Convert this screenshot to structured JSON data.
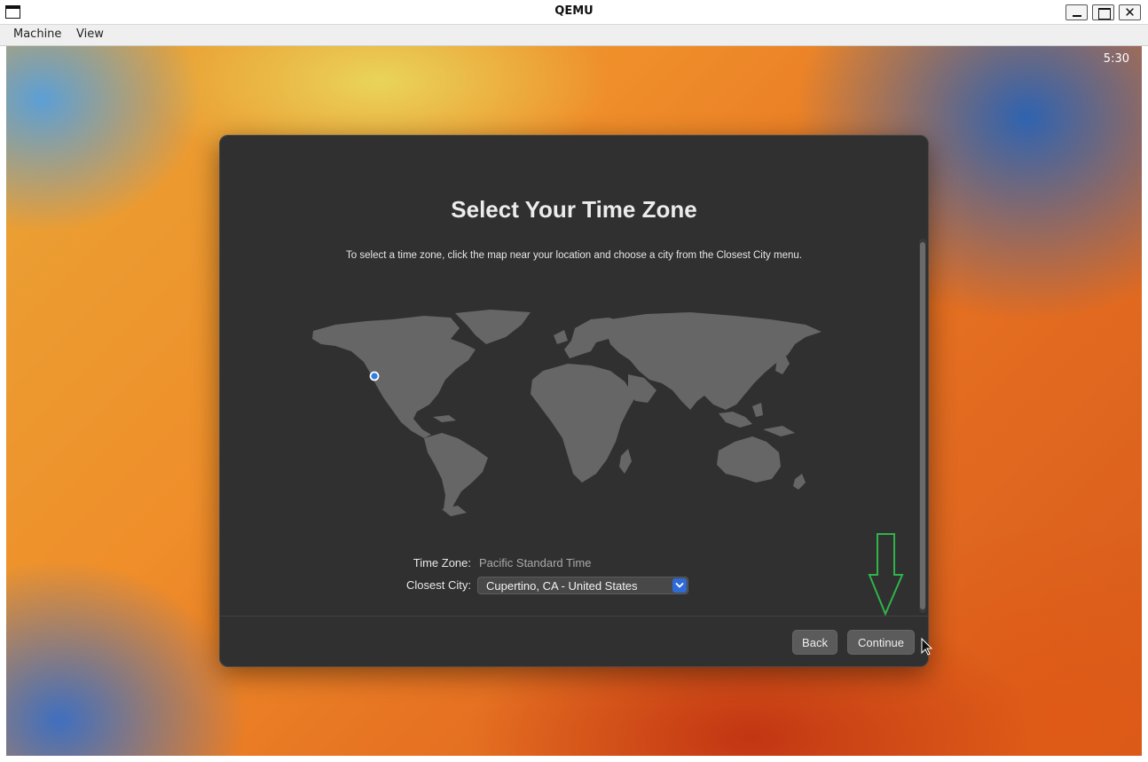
{
  "window": {
    "title": "QEMU",
    "close_glyph": "✕"
  },
  "menubar": {
    "items": [
      {
        "label": "Machine"
      },
      {
        "label": "View"
      }
    ]
  },
  "guest": {
    "clock": "5:30"
  },
  "dialog": {
    "title": "Select Your Time Zone",
    "subtitle": "To select a time zone, click the map near your location and choose a city from the Closest City menu.",
    "time_zone_label": "Time Zone:",
    "time_zone_value": "Pacific Standard Time",
    "closest_city_label": "Closest City:",
    "closest_city_value": "Cupertino, CA - United States",
    "back_label": "Back",
    "continue_label": "Continue"
  },
  "icons": {
    "app": "qemu-window-icon",
    "location_marker": "location-pin-icon",
    "dropdown": "chevron-down-icon",
    "annotation": "green-down-arrow-icon",
    "cursor": "mouse-pointer-icon"
  },
  "colors": {
    "dialog_bg": "#303030",
    "map_land": "#666666",
    "select_accent": "#2f6bd8",
    "annotation_arrow": "#2fb34a"
  }
}
